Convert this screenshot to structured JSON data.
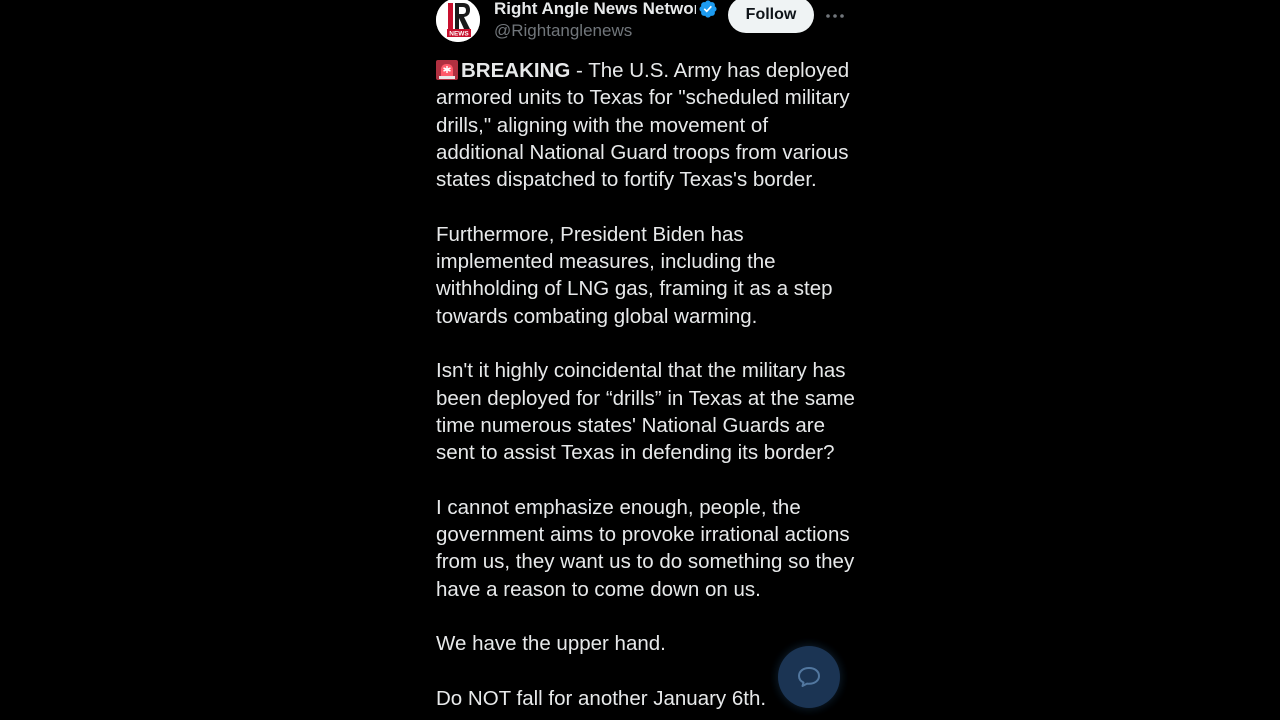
{
  "account": {
    "name": "Right Angle News Network",
    "handle": "@Rightanglenews",
    "avatar_text": "NEWS",
    "verified_icon": "verified-badge-icon"
  },
  "actions": {
    "follow_label": "Follow",
    "more_icon": "more-options-icon",
    "reply_fab_icon": "chat-bubble-icon"
  },
  "post": {
    "p1_emoji": "siren-icon",
    "p1_bold": "BREAKING",
    "p1_line1_rest": " - The U.S. Army has deployed",
    "p1_line2": "armored units to Texas for \"scheduled military",
    "p1_line3": "drills,\" aligning with the movement of",
    "p1_line4": "additional National Guard troops from various",
    "p1_line5": "states dispatched to fortify Texas's border.",
    "p2_line1": "Furthermore, President Biden has",
    "p2_line2": "implemented measures, including the",
    "p2_line3": "withholding of LNG gas, framing it as a step",
    "p2_line4": "towards combating global warming.",
    "p3_line1": "Isn't it highly coincidental that the military has",
    "p3_line2": "been deployed for “drills” in Texas at the same",
    "p3_line3": "time numerous states' National Guards are",
    "p3_line4": "sent to assist Texas in defending its border?",
    "p4_line1": "I cannot emphasize enough, people, the",
    "p4_line2": "government aims to provoke irrational actions",
    "p4_line3": "from us, they want us to do something so they",
    "p4_line4": "have a reason to come down on us.",
    "p5_line1": "We have the upper hand.",
    "p6_line1": "Do NOT fall for another January 6th."
  },
  "colors": {
    "background": "#000000",
    "text": "#e7e9ea",
    "secondary_text": "#71767b",
    "verified_blue": "#1d9bf0",
    "brand_red": "#c8102e",
    "follow_bg": "#eff3f4"
  }
}
